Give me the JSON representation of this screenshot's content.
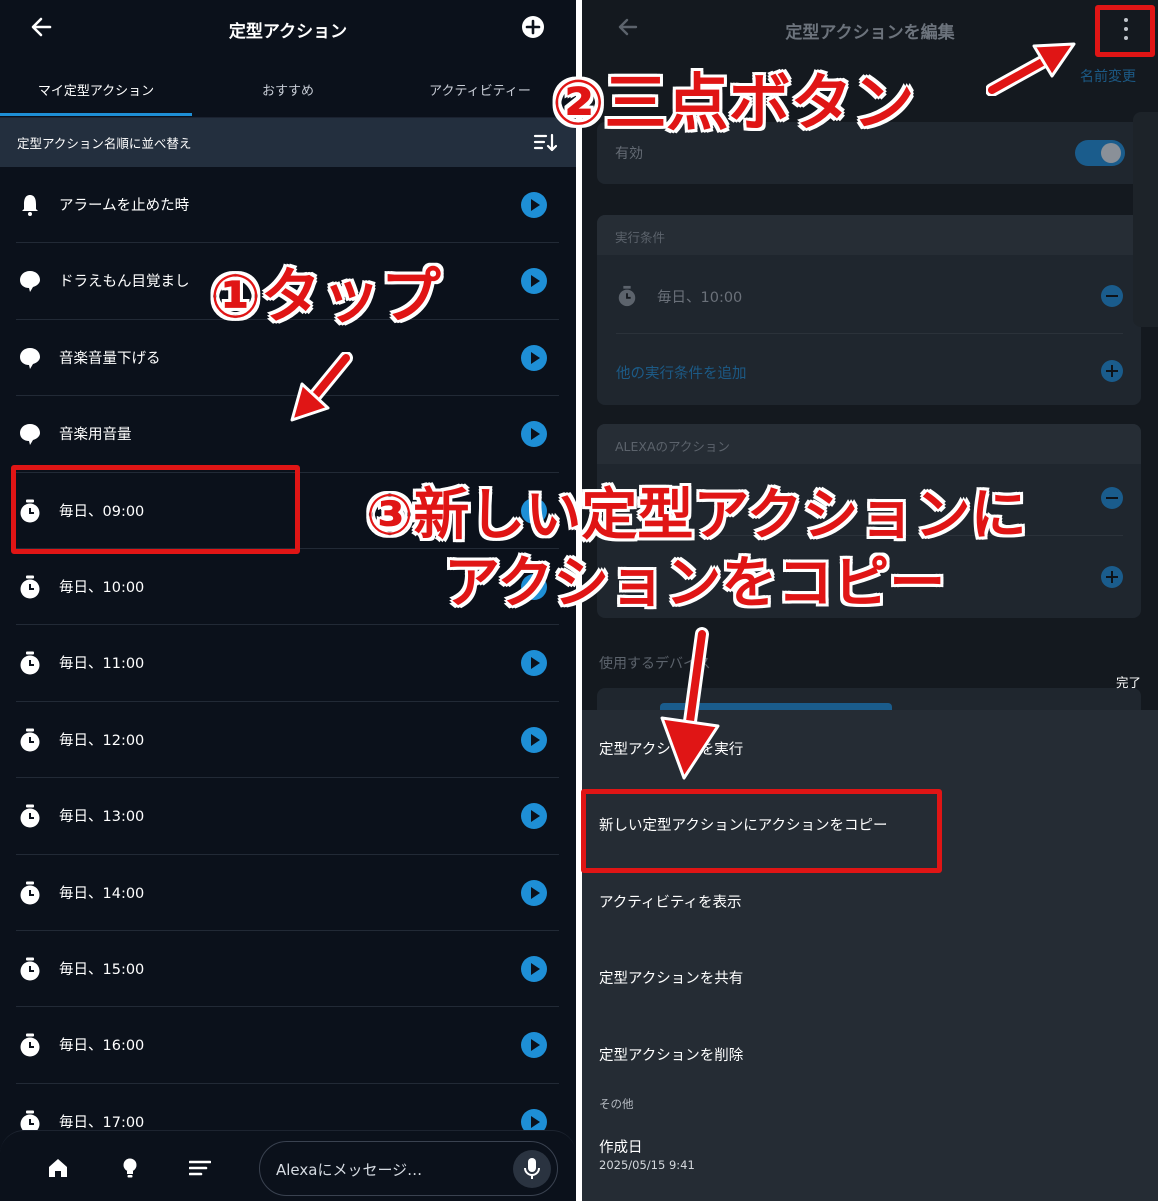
{
  "left": {
    "header": {
      "title": "定型アクション"
    },
    "tabs": [
      {
        "label": "マイ定型アクション",
        "active": true
      },
      {
        "label": "おすすめ",
        "active": false
      },
      {
        "label": "アクティビティー",
        "active": false
      }
    ],
    "sort_label": "定型アクション名順に並べ替え",
    "routines": [
      {
        "label": "アラームを止めた時",
        "icon": "bell-icon"
      },
      {
        "label": "ドラえもん目覚まし",
        "icon": "speech-bubble-icon"
      },
      {
        "label": "音楽音量下げる",
        "icon": "speech-bubble-icon"
      },
      {
        "label": "音楽用音量",
        "icon": "speech-bubble-icon"
      },
      {
        "label": "毎日、09:00",
        "icon": "alarm-clock-icon"
      },
      {
        "label": "毎日、10:00",
        "icon": "alarm-clock-icon"
      },
      {
        "label": "毎日、11:00",
        "icon": "alarm-clock-icon"
      },
      {
        "label": "毎日、12:00",
        "icon": "alarm-clock-icon"
      },
      {
        "label": "毎日、13:00",
        "icon": "alarm-clock-icon"
      },
      {
        "label": "毎日、14:00",
        "icon": "alarm-clock-icon"
      },
      {
        "label": "毎日、15:00",
        "icon": "alarm-clock-icon"
      },
      {
        "label": "毎日、16:00",
        "icon": "alarm-clock-icon"
      },
      {
        "label": "毎日、17:00",
        "icon": "alarm-clock-icon"
      }
    ],
    "bottom": {
      "message_placeholder": "Alexaにメッセージ…"
    }
  },
  "right": {
    "header": {
      "title": "定型アクションを編集",
      "rename": "名前変更"
    },
    "enabled_label": "有効",
    "conditions": {
      "title": "実行条件",
      "item": "毎日、10:00",
      "add": "他の実行条件を追加"
    },
    "actions_title": "ALEXAのアクション",
    "devices_title": "使用するデバイス",
    "done": "完了",
    "menu": [
      "定型アクションを実行",
      "新しい定型アクションにアクションをコピー",
      "アクティビティを表示",
      "定型アクションを共有",
      "定型アクションを削除"
    ],
    "other_label": "その他",
    "created": {
      "label": "作成日",
      "value": "2025/05/15 9:41"
    }
  },
  "annotations": {
    "step1": "①タップ",
    "step2": "②三点ボタン",
    "step3_line1": "③新しい定型アクションに",
    "step3_line2": "アクションをコピー",
    "accent_color": "#e01515"
  }
}
